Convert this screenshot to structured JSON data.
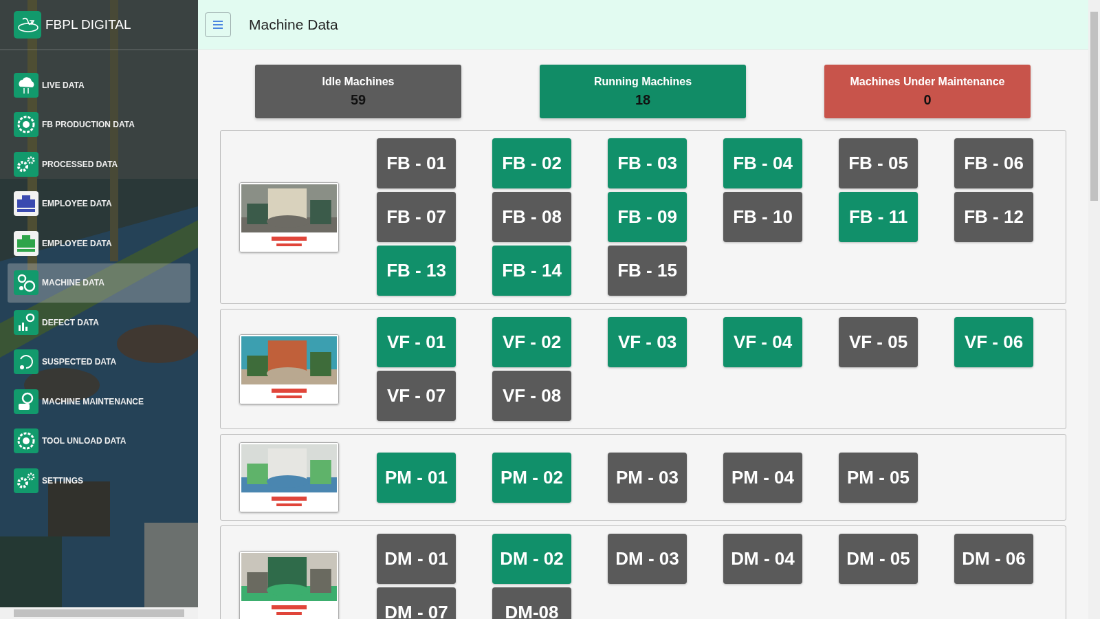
{
  "brand": {
    "name": "FBPL DIGITAL"
  },
  "sidebar": {
    "items": [
      {
        "label": "LIVE DATA",
        "selected": false
      },
      {
        "label": "FB PRODUCTION DATA",
        "selected": false
      },
      {
        "label": "PROCESSED DATA",
        "selected": false
      },
      {
        "label": "EMPLOYEE DATA",
        "selected": false
      },
      {
        "label": "EMPLOYEE DATA",
        "selected": false
      },
      {
        "label": "MACHINE DATA",
        "selected": true
      },
      {
        "label": "DEFECT DATA",
        "selected": false
      },
      {
        "label": "SUSPECTED DATA",
        "selected": false
      },
      {
        "label": "MACHINE MAINTENANCE",
        "selected": false
      },
      {
        "label": "TOOL UNLOAD DATA",
        "selected": false
      },
      {
        "label": "SETTINGS",
        "selected": false
      }
    ]
  },
  "header": {
    "title": "Machine Data"
  },
  "summary": [
    {
      "kind": "idle",
      "label": "Idle Machines",
      "count": "59"
    },
    {
      "kind": "running",
      "label": "Running Machines",
      "count": "18"
    },
    {
      "kind": "maintenance",
      "label": "Machines Under Maintenance",
      "count": "0"
    }
  ],
  "groups": [
    {
      "machines": [
        {
          "label": "FB - 01",
          "running": false
        },
        {
          "label": "FB - 02",
          "running": true
        },
        {
          "label": "FB - 03",
          "running": true
        },
        {
          "label": "FB - 04",
          "running": true
        },
        {
          "label": "FB - 05",
          "running": false
        },
        {
          "label": "FB - 06",
          "running": false
        },
        {
          "label": "FB - 07",
          "running": false
        },
        {
          "label": "FB - 08",
          "running": false
        },
        {
          "label": "FB - 09",
          "running": true
        },
        {
          "label": "FB - 10",
          "running": false
        },
        {
          "label": "FB - 11",
          "running": true
        },
        {
          "label": "FB - 12",
          "running": false
        },
        {
          "label": "FB - 13",
          "running": true
        },
        {
          "label": "FB - 14",
          "running": true
        },
        {
          "label": "FB - 15",
          "running": false
        }
      ]
    },
    {
      "machines": [
        {
          "label": "VF - 01",
          "running": true
        },
        {
          "label": "VF - 02",
          "running": true
        },
        {
          "label": "VF - 03",
          "running": true
        },
        {
          "label": "VF - 04",
          "running": true
        },
        {
          "label": "VF - 05",
          "running": false
        },
        {
          "label": "VF - 06",
          "running": true
        },
        {
          "label": "VF - 07",
          "running": false
        },
        {
          "label": "VF - 08",
          "running": false
        }
      ]
    },
    {
      "machines": [
        {
          "label": "PM - 01",
          "running": true
        },
        {
          "label": "PM - 02",
          "running": true
        },
        {
          "label": "PM - 03",
          "running": false
        },
        {
          "label": "PM - 04",
          "running": false
        },
        {
          "label": "PM - 05",
          "running": false
        }
      ]
    },
    {
      "machines": [
        {
          "label": "DM - 01",
          "running": false
        },
        {
          "label": "DM - 02",
          "running": true
        },
        {
          "label": "DM - 03",
          "running": false
        },
        {
          "label": "DM - 04",
          "running": false
        },
        {
          "label": "DM - 05",
          "running": false
        },
        {
          "label": "DM - 06",
          "running": false
        },
        {
          "label": "DM - 07",
          "running": false
        },
        {
          "label": "DM-08",
          "running": false
        }
      ]
    }
  ]
}
